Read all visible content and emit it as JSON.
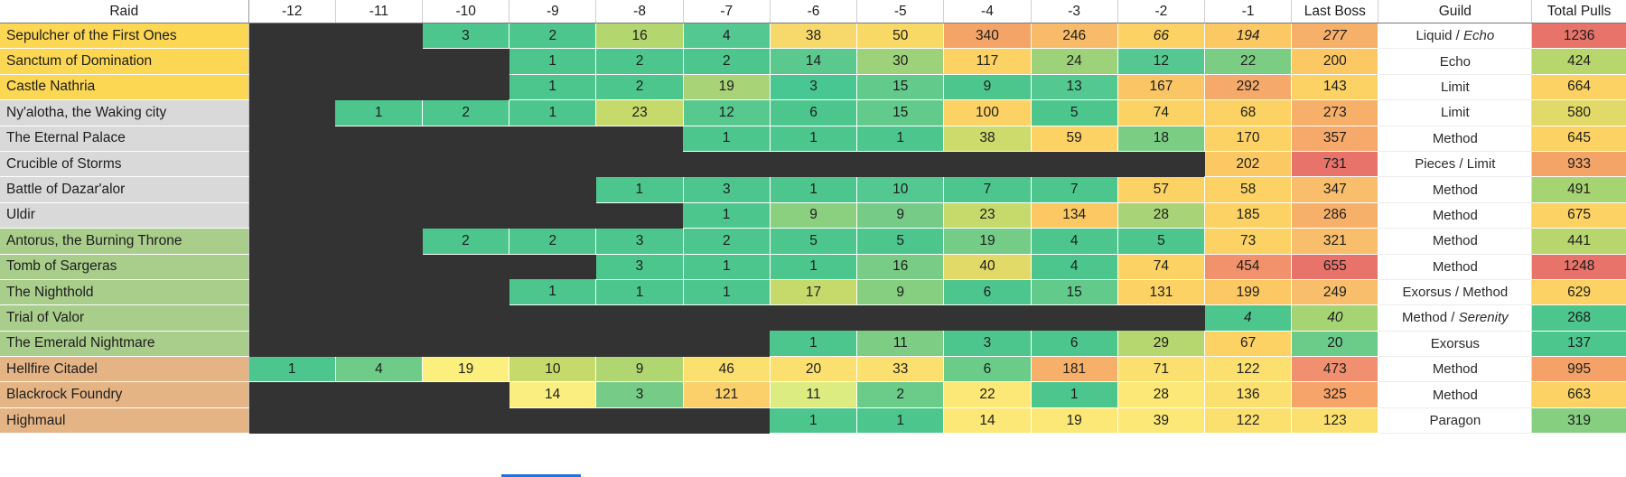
{
  "table": {
    "headers": [
      "Raid",
      "-12",
      "-11",
      "-10",
      "-9",
      "-8",
      "-7",
      "-6",
      "-5",
      "-4",
      "-3",
      "-2",
      "-1",
      "Last Boss",
      "Guild",
      "Total Pulls"
    ],
    "raid_label_colors": {
      "shadowlands": "#fcd753",
      "bfa": "#d9d9d9",
      "legion": "#a9cd8b",
      "wod": "#e5b485"
    },
    "rows": [
      {
        "raid": "Sepulcher of the First Ones",
        "raid_bg": "#fcd753",
        "pulls": [
          null,
          null,
          "3",
          "2",
          "16",
          "4",
          "38",
          "50",
          "340",
          "246",
          "66",
          "194"
        ],
        "pull_colors": [
          null,
          null,
          "#4dc68e",
          "#4dc68e",
          "#b3d66f",
          "#53c890",
          "#f7d96b",
          "#f9d966",
          "#f4a467",
          "#f7bb6a",
          "#fbd263",
          "#fbc863"
        ],
        "pull_italic": [
          false,
          false,
          false,
          false,
          false,
          false,
          false,
          false,
          false,
          false,
          true,
          true
        ],
        "last_boss": "277",
        "last_boss_color": "#f7b06a",
        "last_boss_italic": true,
        "guild": "Liquid / Echo",
        "guild_italic_part": "Echo",
        "total": "1236",
        "total_color": "#e8736a"
      },
      {
        "raid": "Sanctum of Domination",
        "raid_bg": "#fcd753",
        "pulls": [
          null,
          null,
          null,
          "1",
          "2",
          "2",
          "14",
          "30",
          "117",
          "24",
          "12",
          "22"
        ],
        "pull_colors": [
          null,
          null,
          null,
          "#4dc68e",
          "#4dc68e",
          "#4dc68e",
          "#5bc98d",
          "#9dd27a",
          "#fbd263",
          "#9dd27a",
          "#54c890",
          "#7ccd84"
        ],
        "pull_italic": [
          false,
          false,
          false,
          false,
          false,
          false,
          false,
          false,
          false,
          false,
          false,
          false
        ],
        "last_boss": "200",
        "last_boss_color": "#fbc863",
        "last_boss_italic": false,
        "guild": "Echo",
        "guild_italic_part": "",
        "total": "424",
        "total_color": "#b7d76e"
      },
      {
        "raid": "Castle Nathria",
        "raid_bg": "#fcd753",
        "pulls": [
          null,
          null,
          null,
          "1",
          "2",
          "19",
          "3",
          "15",
          "9",
          "13",
          "167",
          "292"
        ],
        "pull_colors": [
          null,
          null,
          null,
          "#4dc68e",
          "#4dc68e",
          "#a8d477",
          "#49c792",
          "#62ca8b",
          "#4dc68e",
          "#53c890",
          "#fac565",
          "#f5a96a"
        ],
        "pull_italic": [
          false,
          false,
          false,
          false,
          false,
          false,
          false,
          false,
          false,
          false,
          false,
          false
        ],
        "last_boss": "143",
        "last_boss_color": "#fbd263",
        "last_boss_italic": false,
        "guild": "Limit",
        "guild_italic_part": "",
        "total": "664",
        "total_color": "#fbd263"
      },
      {
        "raid": "Ny'alotha, the Waking city",
        "raid_bg": "#d9d9d9",
        "pulls": [
          null,
          "1",
          "2",
          "1",
          "23",
          "12",
          "6",
          "15",
          "100",
          "5",
          "74",
          "68"
        ],
        "pull_colors": [
          null,
          "#4dc68e",
          "#4dc68e",
          "#4dc68e",
          "#c6da6c",
          "#57c98e",
          "#4dc68e",
          "#62ca8b",
          "#fbd263",
          "#4dc68e",
          "#fbd263",
          "#fbd263"
        ],
        "pull_italic": [
          false,
          false,
          false,
          false,
          false,
          false,
          false,
          false,
          false,
          false,
          false,
          false
        ],
        "last_boss": "273",
        "last_boss_color": "#f7b06a",
        "last_boss_italic": false,
        "guild": "Limit",
        "guild_italic_part": "",
        "total": "580",
        "total_color": "#e1d968"
      },
      {
        "raid": "The Eternal Palace",
        "raid_bg": "#d9d9d9",
        "pulls": [
          null,
          null,
          null,
          null,
          null,
          "1",
          "1",
          "1",
          "38",
          "59",
          "18",
          "170"
        ],
        "pull_colors": [
          null,
          null,
          null,
          null,
          null,
          "#4dc68e",
          "#4dc68e",
          "#4dc68e",
          "#ccdb6b",
          "#fbd263",
          "#7ccd84",
          "#fbd263"
        ],
        "pull_italic": [
          false,
          false,
          false,
          false,
          false,
          false,
          false,
          false,
          false,
          false,
          false,
          false
        ],
        "last_boss": "357",
        "last_boss_color": "#f5a96a",
        "last_boss_italic": false,
        "guild": "Method",
        "guild_italic_part": "",
        "total": "645",
        "total_color": "#fbd263"
      },
      {
        "raid": "Crucible of Storms",
        "raid_bg": "#d9d9d9",
        "pulls": [
          null,
          null,
          null,
          null,
          null,
          null,
          null,
          null,
          null,
          null,
          null,
          "202"
        ],
        "pull_colors": [
          null,
          null,
          null,
          null,
          null,
          null,
          null,
          null,
          null,
          null,
          null,
          "#fbc863"
        ],
        "pull_italic": [
          false,
          false,
          false,
          false,
          false,
          false,
          false,
          false,
          false,
          false,
          false,
          false
        ],
        "last_boss": "731",
        "last_boss_color": "#e8736a",
        "last_boss_italic": false,
        "guild": "Pieces / Limit",
        "guild_italic_part": "",
        "total": "933",
        "total_color": "#f4a467"
      },
      {
        "raid": "Battle of Dazar'alor",
        "raid_bg": "#d9d9d9",
        "pulls": [
          null,
          null,
          null,
          null,
          "1",
          "3",
          "1",
          "10",
          "7",
          "7",
          "57",
          "58"
        ],
        "pull_colors": [
          null,
          null,
          null,
          null,
          "#4dc68e",
          "#4dc68e",
          "#4dc68e",
          "#53c890",
          "#4dc68e",
          "#4dc68e",
          "#fbd263",
          "#fbd263"
        ],
        "pull_italic": [
          false,
          false,
          false,
          false,
          false,
          false,
          false,
          false,
          false,
          false,
          false,
          false
        ],
        "last_boss": "347",
        "last_boss_color": "#f8be6b",
        "last_boss_italic": false,
        "guild": "Method",
        "guild_italic_part": "",
        "total": "491",
        "total_color": "#a7d473"
      },
      {
        "raid": "Uldir",
        "raid_bg": "#d9d9d9",
        "pulls": [
          null,
          null,
          null,
          null,
          null,
          "1",
          "9",
          "9",
          "23",
          "134",
          "28",
          "185"
        ],
        "pull_colors": [
          null,
          null,
          null,
          null,
          null,
          "#4dc68e",
          "#8ad07f",
          "#76cc86",
          "#c6da6c",
          "#fbc863",
          "#a8d477",
          "#fbd263"
        ],
        "pull_italic": [
          false,
          false,
          false,
          false,
          false,
          false,
          false,
          false,
          false,
          false,
          false,
          false
        ],
        "last_boss": "286",
        "last_boss_color": "#f7b06a",
        "last_boss_italic": false,
        "guild": "Method",
        "guild_italic_part": "",
        "total": "675",
        "total_color": "#fbd263"
      },
      {
        "raid": "Antorus, the Burning Throne",
        "raid_bg": "#a9cd8b",
        "pulls": [
          null,
          null,
          "2",
          "2",
          "3",
          "2",
          "5",
          "5",
          "19",
          "4",
          "5",
          "73"
        ],
        "pull_colors": [
          null,
          null,
          "#4dc68e",
          "#4dc68e",
          "#4dc68e",
          "#4dc68e",
          "#4dc68e",
          "#4dc68e",
          "#74cc87",
          "#4dc68e",
          "#4dc68e",
          "#fbd263"
        ],
        "pull_italic": [
          false,
          false,
          false,
          false,
          false,
          false,
          false,
          false,
          false,
          false,
          false,
          false
        ],
        "last_boss": "321",
        "last_boss_color": "#f8be6b",
        "last_boss_italic": false,
        "guild": "Method",
        "guild_italic_part": "",
        "total": "441",
        "total_color": "#b7d76e"
      },
      {
        "raid": "Tomb of Sargeras",
        "raid_bg": "#a9cd8b",
        "pulls": [
          null,
          null,
          null,
          null,
          "3",
          "1",
          "1",
          "16",
          "40",
          "4",
          "74",
          "454"
        ],
        "pull_colors": [
          null,
          null,
          null,
          null,
          "#4dc68e",
          "#4dc68e",
          "#4dc68e",
          "#79cc85",
          "#e1d968",
          "#4dc68e",
          "#fbd263",
          "#f1926c"
        ],
        "pull_italic": [
          false,
          false,
          false,
          false,
          false,
          false,
          false,
          false,
          false,
          false,
          false,
          false
        ],
        "last_boss": "655",
        "last_boss_color": "#e8736a",
        "last_boss_italic": false,
        "guild": "Method",
        "guild_italic_part": "",
        "total": "1248",
        "total_color": "#e8736a"
      },
      {
        "raid": "The Nighthold",
        "raid_bg": "#a9cd8b",
        "pulls": [
          null,
          null,
          null,
          "1",
          "1",
          "1",
          "17",
          "9",
          "6",
          "15",
          "131",
          "199"
        ],
        "pull_colors": [
          null,
          null,
          null,
          "#4dc68e",
          "#4dc68e",
          "#4dc68e",
          "#c6da6c",
          "#86cf81",
          "#4dc68e",
          "#62ca8b",
          "#fbd263",
          "#fbc863"
        ],
        "pull_italic": [
          false,
          false,
          false,
          false,
          false,
          false,
          false,
          false,
          false,
          false,
          false,
          false
        ],
        "last_boss": "249",
        "last_boss_color": "#f8be6b",
        "last_boss_italic": false,
        "guild": "Exorsus / Method",
        "guild_italic_part": "",
        "total": "629",
        "total_color": "#fbd263"
      },
      {
        "raid": "Trial of Valor",
        "raid_bg": "#a9cd8b",
        "pulls": [
          null,
          null,
          null,
          null,
          null,
          null,
          null,
          null,
          null,
          null,
          null,
          "4"
        ],
        "pull_colors": [
          null,
          null,
          null,
          null,
          null,
          null,
          null,
          null,
          null,
          null,
          null,
          "#4dc68e"
        ],
        "pull_italic": [
          false,
          false,
          false,
          false,
          false,
          false,
          false,
          false,
          false,
          false,
          false,
          true
        ],
        "last_boss": "40",
        "last_boss_color": "#a7d473",
        "last_boss_italic": true,
        "guild": "Method / Serenity",
        "guild_italic_part": "Serenity",
        "total": "268",
        "total_color": "#4dc68e"
      },
      {
        "raid": "The Emerald Nightmare",
        "raid_bg": "#a9cd8b",
        "pulls": [
          null,
          null,
          null,
          null,
          null,
          null,
          "1",
          "11",
          "3",
          "6",
          "29",
          "67"
        ],
        "pull_colors": [
          null,
          null,
          null,
          null,
          null,
          null,
          "#4dc68e",
          "#7ecd84",
          "#4dc68e",
          "#4dc68e",
          "#b6d76f",
          "#fbd263"
        ],
        "pull_italic": [
          false,
          false,
          false,
          false,
          false,
          false,
          false,
          false,
          false,
          false,
          false,
          false
        ],
        "last_boss": "20",
        "last_boss_color": "#6bcb89",
        "last_boss_italic": false,
        "guild": "Exorsus",
        "guild_italic_part": "",
        "total": "137",
        "total_color": "#4dc68e"
      },
      {
        "raid": "Hellfire Citadel",
        "raid_bg": "#e5b485",
        "pulls": [
          "1",
          "4",
          "19",
          "10",
          "9",
          "46",
          "20",
          "33",
          "6",
          "181",
          "71",
          "122"
        ],
        "pull_colors": [
          "#4dc68e",
          "#6fcb88",
          "#fbef7e",
          "#c6da6c",
          "#b0d671",
          "#fbe070",
          "#fbe070",
          "#fbe070",
          "#6bcb89",
          "#f7b06a",
          "#fbe070",
          "#fbe070"
        ],
        "pull_italic": [
          false,
          false,
          false,
          false,
          false,
          false,
          false,
          false,
          false,
          false,
          false,
          false
        ],
        "last_boss": "473",
        "last_boss_color": "#f19071",
        "last_boss_italic": false,
        "guild": "Method",
        "guild_italic_part": "",
        "total": "995",
        "total_color": "#f5a268"
      },
      {
        "raid": "Blackrock Foundry",
        "raid_bg": "#e5b485",
        "pulls": [
          null,
          null,
          null,
          "14",
          "3",
          "121",
          "11",
          "2",
          "22",
          "1",
          "28",
          "136"
        ],
        "pull_colors": [
          null,
          null,
          null,
          "#fbee80",
          "#76cc86",
          "#fbd06a",
          "#ddec80",
          "#6bcb89",
          "#fbe877",
          "#4dc68e",
          "#fbe877",
          "#fbe070"
        ],
        "pull_italic": [
          false,
          false,
          false,
          false,
          false,
          false,
          false,
          false,
          false,
          false,
          false,
          false
        ],
        "last_boss": "325",
        "last_boss_color": "#f7a46a",
        "last_boss_italic": false,
        "guild": "Method",
        "guild_italic_part": "",
        "total": "663",
        "total_color": "#fbd263"
      },
      {
        "raid": "Highmaul",
        "raid_bg": "#e5b485",
        "pulls": [
          null,
          null,
          null,
          null,
          null,
          null,
          "1",
          "1",
          "14",
          "19",
          "39",
          "122"
        ],
        "pull_colors": [
          null,
          null,
          null,
          null,
          null,
          null,
          "#4dc68e",
          "#4dc68e",
          "#fbe877",
          "#fbe877",
          "#fbe877",
          "#fbe070"
        ],
        "pull_italic": [
          false,
          false,
          false,
          false,
          false,
          false,
          false,
          false,
          false,
          false,
          false,
          false
        ],
        "last_boss": "123",
        "last_boss_color": "#fbe070",
        "last_boss_italic": false,
        "guild": "Paragon",
        "guild_italic_part": "",
        "total": "319",
        "total_color": "#86cf81"
      }
    ]
  },
  "selection": {
    "accent_color": "#1a73e8"
  }
}
